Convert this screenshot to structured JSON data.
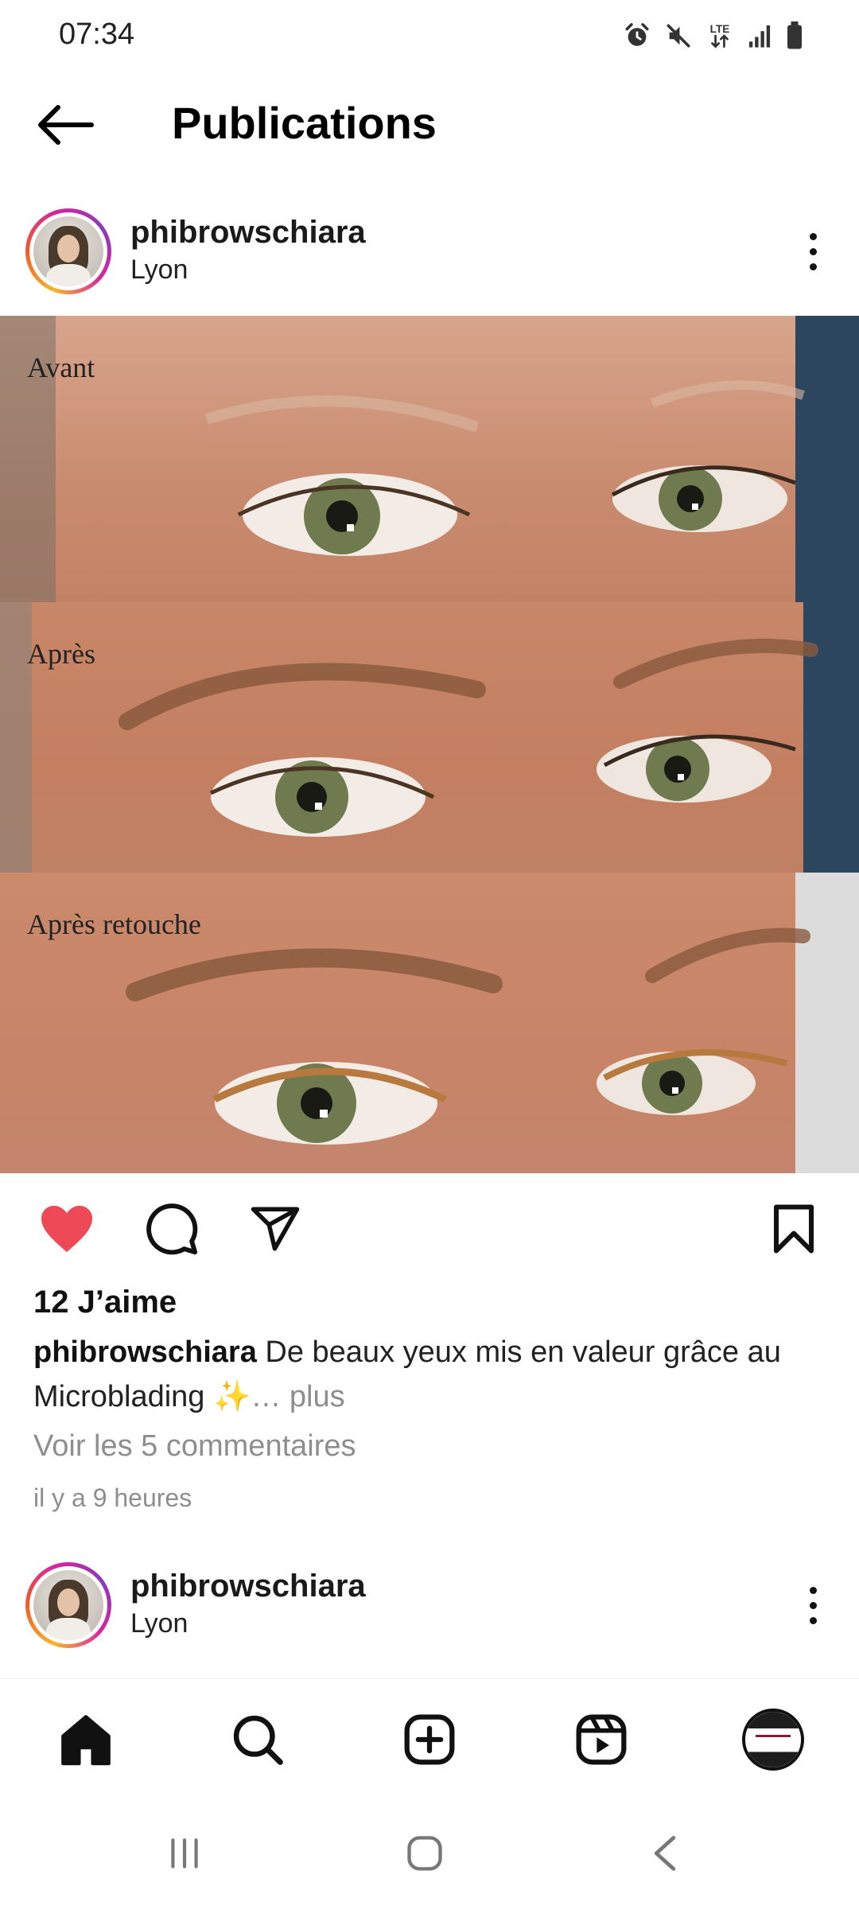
{
  "status_bar": {
    "time": "07:34",
    "network": "LTE",
    "icons": [
      "alarm-icon",
      "mute-icon",
      "lte-icon",
      "signal-icon",
      "battery-icon"
    ]
  },
  "app_bar": {
    "title": "Publications",
    "back_icon": "back-arrow-icon"
  },
  "post": {
    "username": "phibrowschiara",
    "location": "Lyon",
    "image_labels": [
      "Avant",
      "Après",
      "Après retouche"
    ],
    "liked": true,
    "like_color": "#ed4956",
    "likes_text": "12 J’aime",
    "caption_user": "phibrowschiara",
    "caption_text": " De beaux yeux mis en valeur grâce au Microblading ✨",
    "caption_more": "… plus",
    "comments_link": "Voir les 5 commentaires",
    "timestamp": "il y a 9 heures"
  },
  "next_post": {
    "username": "phibrowschiara",
    "location": "Lyon"
  },
  "bottom_nav": {
    "items": [
      "home-icon",
      "search-icon",
      "create-icon",
      "reels-icon",
      "profile-avatar"
    ],
    "active": "home"
  },
  "system_nav": [
    "recent-apps-icon",
    "home-button-icon",
    "back-icon"
  ]
}
